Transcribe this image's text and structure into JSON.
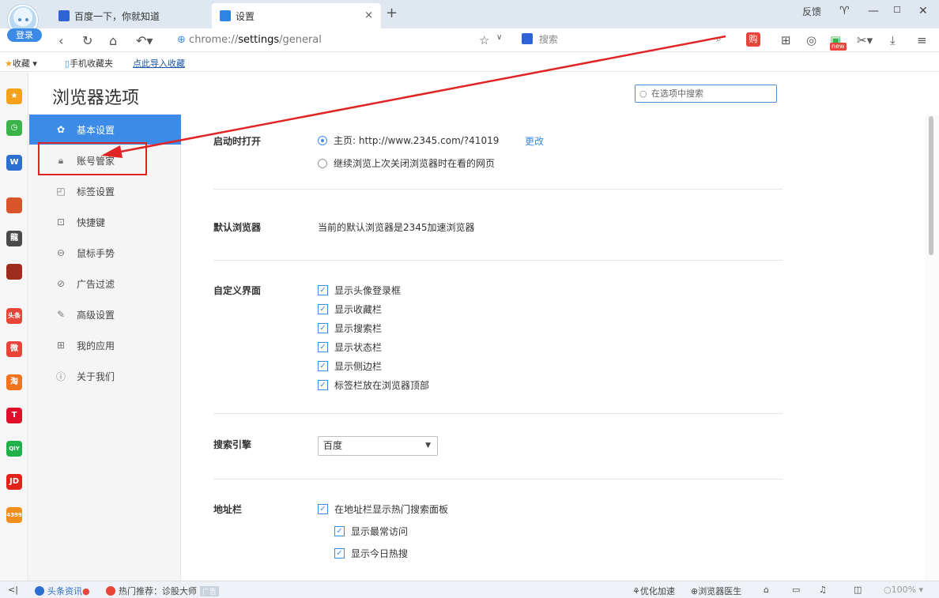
{
  "browser": {
    "login_label": "登录",
    "tabs": [
      {
        "label": "百度一下，你就知道"
      },
      {
        "label": "设置"
      }
    ],
    "window": {
      "feedback": "反馈"
    },
    "address": {
      "scheme": "chrome://",
      "host": "settings",
      "path": "/general"
    },
    "search_placeholder": "搜索",
    "shop_label": "购",
    "new_badge": "new"
  },
  "bookmarks": {
    "favorites": "收藏",
    "mobile": "手机收藏夹",
    "import": "点此导入收藏"
  },
  "left_apps": [
    {
      "label": "★",
      "color": "#f4a11b"
    },
    {
      "label": "◷",
      "color": "#3cb34a"
    },
    {
      "label": "W",
      "color": "#2d6fd1"
    },
    {
      "label": "",
      "color": "#d9552a"
    },
    {
      "label": "龍",
      "color": "#4a4a4a"
    },
    {
      "label": "",
      "color": "#a02c1e"
    },
    {
      "label": "头条",
      "color": "#e8443a"
    },
    {
      "label": "微",
      "color": "#e8443a"
    },
    {
      "label": "淘",
      "color": "#f3731c"
    },
    {
      "label": "T",
      "color": "#e0102a"
    },
    {
      "label": "QIY",
      "color": "#22b04a"
    },
    {
      "label": "JD",
      "color": "#e2231a"
    },
    {
      "label": "4399",
      "color": "#f28e1c"
    }
  ],
  "settings": {
    "title": "浏览器选项",
    "search_placeholder": "在选项中搜索",
    "nav": [
      {
        "label": "基本设置"
      },
      {
        "label": "账号管家"
      },
      {
        "label": "标签设置"
      },
      {
        "label": "快捷键"
      },
      {
        "label": "鼠标手势"
      },
      {
        "label": "广告过滤"
      },
      {
        "label": "高级设置"
      },
      {
        "label": "我的应用"
      },
      {
        "label": "关于我们"
      }
    ],
    "startup": {
      "label": "启动时打开",
      "homepage": "主页: http://www.2345.com/?41019",
      "change": "更改",
      "continue": "继续浏览上次关闭浏览器时在看的网页"
    },
    "default_browser": {
      "label": "默认浏览器",
      "text": "当前的默认浏览器是2345加速浏览器"
    },
    "custom_ui": {
      "label": "自定义界面",
      "options": [
        "显示头像登录框",
        "显示收藏栏",
        "显示搜索栏",
        "显示状态栏",
        "显示侧边栏",
        "标签栏放在浏览器顶部"
      ]
    },
    "search_engine": {
      "label": "搜索引擎",
      "selected": "百度"
    },
    "address_bar": {
      "label": "地址栏",
      "main_option": "在地址栏显示热门搜索面板",
      "sub_options": [
        "显示最常访问",
        "显示今日热搜"
      ]
    }
  },
  "status": {
    "news": "头条资讯",
    "hot": "热门推荐：诊股大师",
    "ad": "广告",
    "speedup": "优化加速",
    "doctor": "浏览器医生",
    "zoom": "100%"
  },
  "colors": {
    "accent": "#3c8be6",
    "annotation": "#e02424"
  }
}
